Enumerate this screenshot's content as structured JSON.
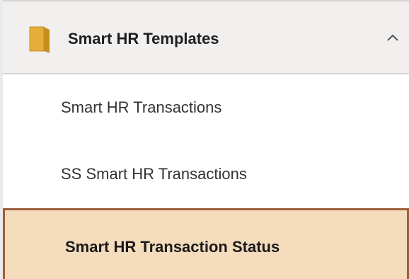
{
  "nav": {
    "group": {
      "title": "Smart HR Templates",
      "icon": "folder-icon",
      "expand_icon": "chevron-up-icon",
      "expanded": true
    },
    "items": [
      {
        "label": "Smart HR Transactions",
        "selected": false
      },
      {
        "label": "SS Smart HR Transactions",
        "selected": false
      },
      {
        "label": "Smart HR Transaction Status",
        "selected": true
      }
    ]
  },
  "colors": {
    "header_bg": "#f1f0ef",
    "selected_bg": "#f5dcbd",
    "selected_border": "#9c5e3a",
    "folder_icon": "#e0a734"
  }
}
